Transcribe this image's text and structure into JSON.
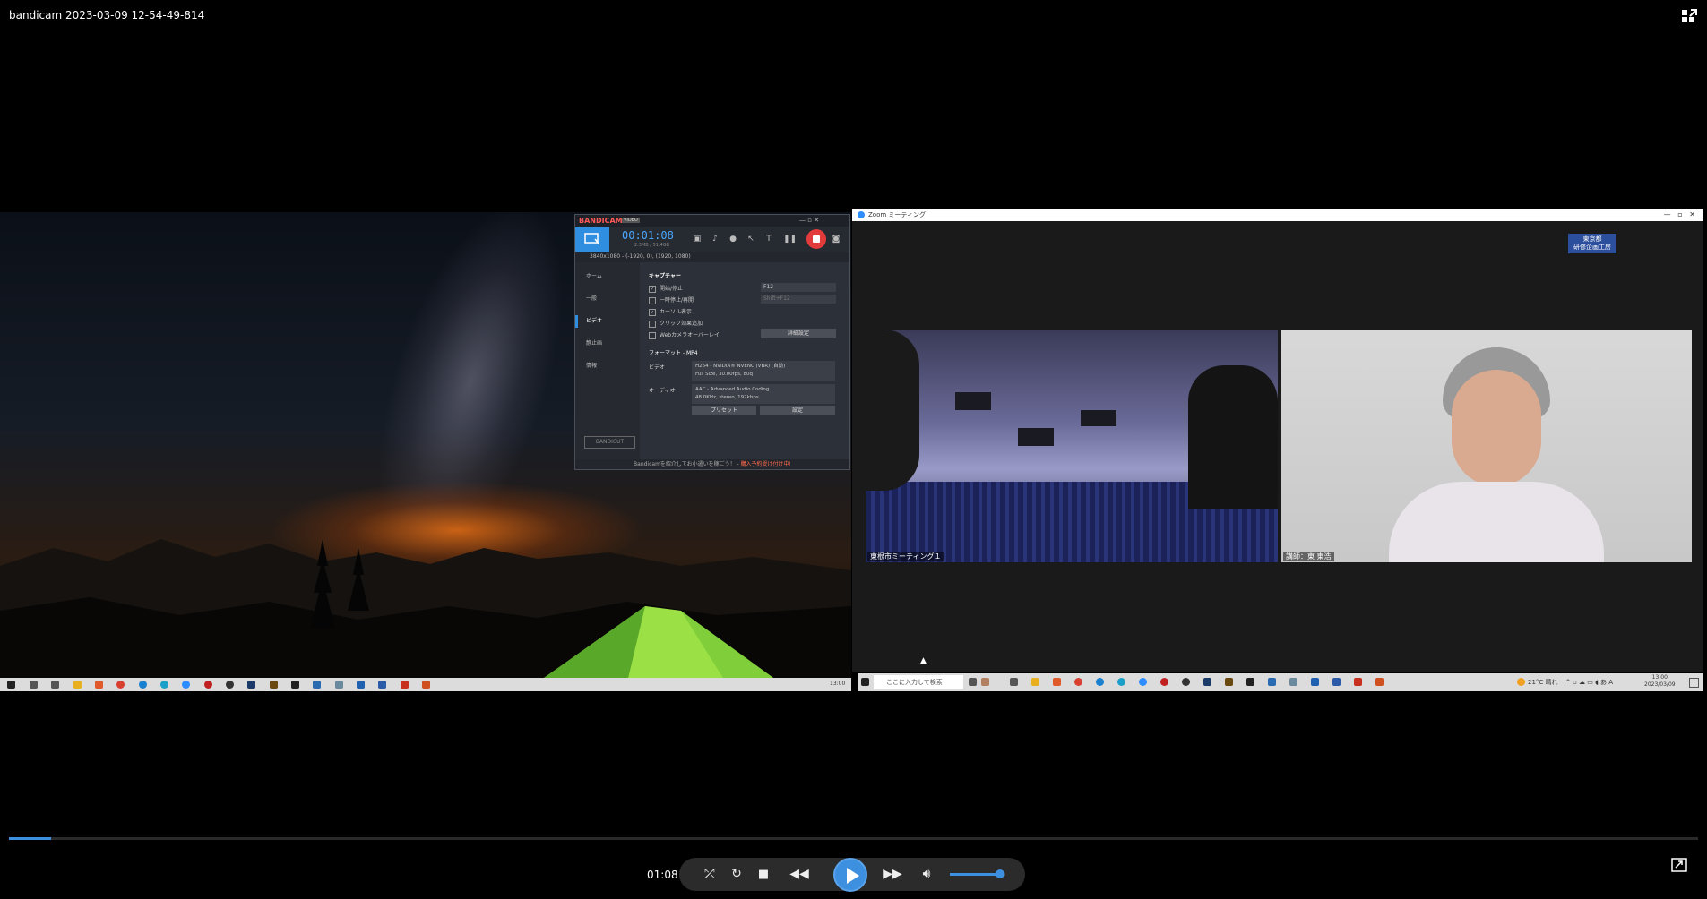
{
  "player": {
    "title": "bandicam 2023-03-09 12-54-49-814",
    "current_time": "01:08",
    "progress_fraction": 0.025,
    "volume_fraction": 0.9,
    "accent_color": "#3d8fe0",
    "icons": [
      "fullscreen-toggle-icon",
      "repeat-ab-icon",
      "loop-icon",
      "stop-icon",
      "rewind-icon",
      "play-icon",
      "fast-forward-icon",
      "volume-icon",
      "pip-icon"
    ]
  },
  "bandicam": {
    "logo_main": "BANDI",
    "logo_accent": "CAM",
    "badge": "VIDEO",
    "timer": "00:01:08",
    "file_size": "2.3MB / 51.4GB",
    "resolution": "3840x1080 - (-1920, 0), (1920, 1080)",
    "nav": [
      "ホーム",
      "一般",
      "ビデオ",
      "静止画",
      "情報"
    ],
    "capture_heading": "キャプチャー",
    "options": [
      {
        "label": "開始/停止",
        "checked": true
      },
      {
        "label": "一時停止/再開",
        "checked": false
      },
      {
        "label": "カーソル表示",
        "checked": true
      },
      {
        "label": "クリック効果追加",
        "checked": false
      },
      {
        "label": "Webカメラオーバーレイ",
        "checked": false
      }
    ],
    "hotkey1": "F12",
    "hotkey2": "Shift+F12",
    "detail_button": "詳細設定",
    "format_heading": "フォーマット - MP4",
    "video_label": "ビデオ",
    "video_line1": "H264 - NVIDIA® NVENC (VBR) (自動)",
    "video_line2": "Full Size, 30.00fps, 80q",
    "audio_label": "オーディオ",
    "audio_line1": "AAC - Advanced Audio Coding",
    "audio_line2": "48.0KHz, stereo, 192kbps",
    "preset_button": "プリセット",
    "settings_button": "設定",
    "bandicut": "BANDICUT",
    "footer_text": "Bandicamを紹介してお小遣いを稼ごう！ - ",
    "footer_link": "購入予約受け付け中!"
  },
  "zoom": {
    "title": "Zoom ミーティング",
    "badge_line1": "東京都",
    "badge_line2": "研修企画工房",
    "tile_left_name": "東根市ミーティング１",
    "tile_right_name": "講師：東 東浩"
  },
  "taskbar": {
    "search_placeholder": "ここに入力して検索",
    "weather": "21°C 晴れ",
    "clock_time": "13:00",
    "clock_date": "2023/03/09",
    "left_clock": "13:00"
  }
}
